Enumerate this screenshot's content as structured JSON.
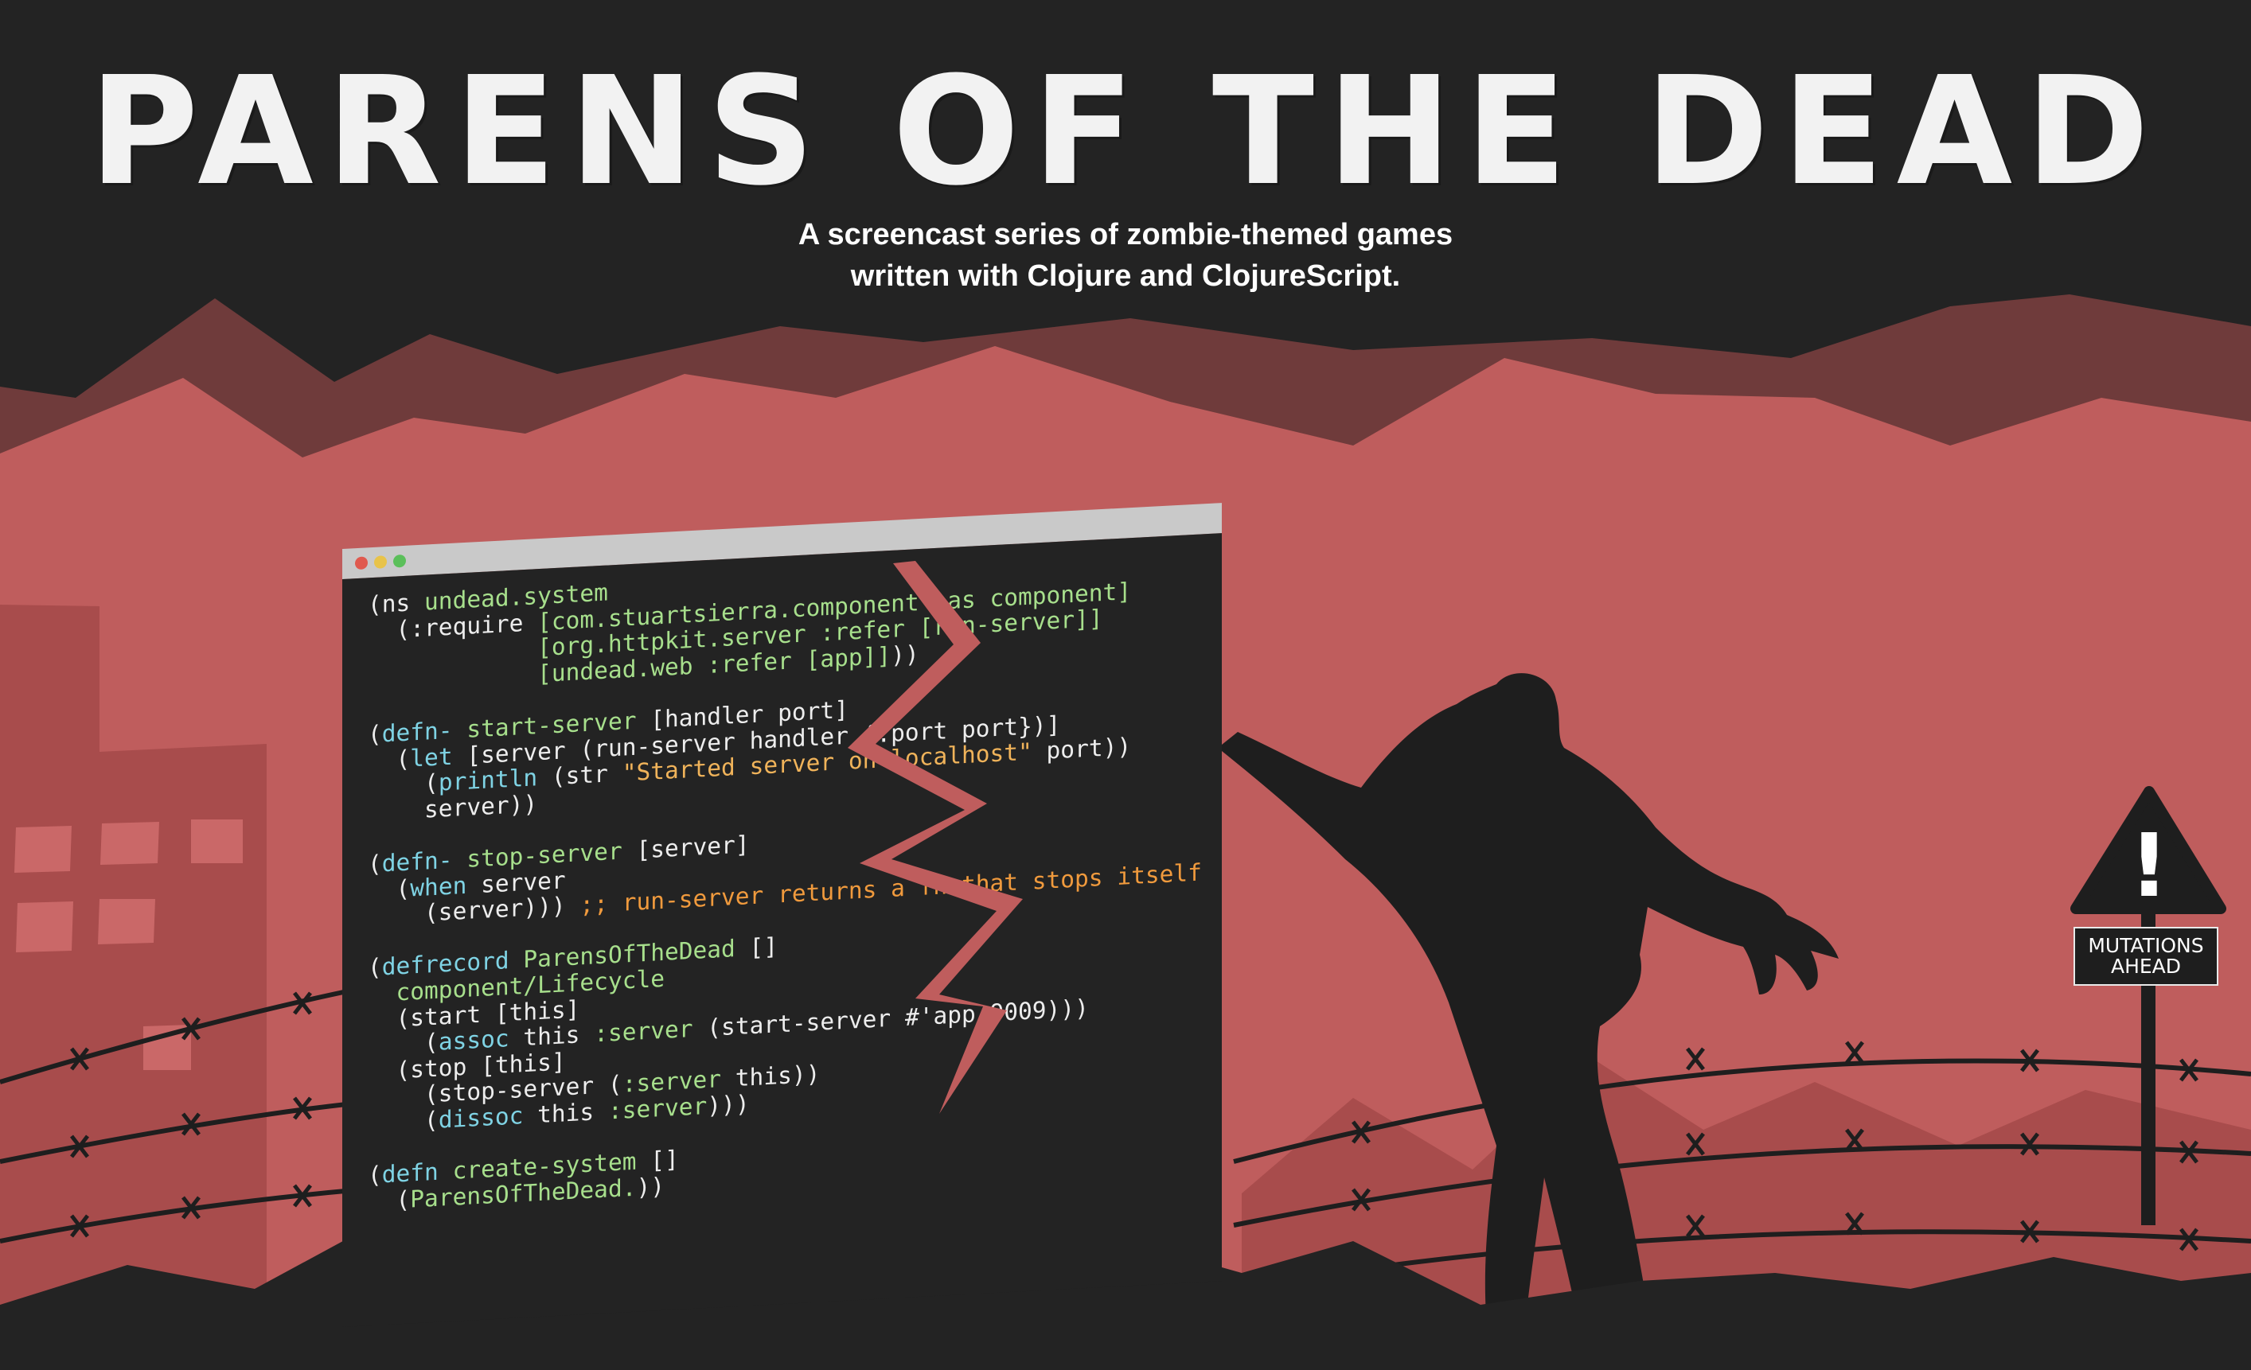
{
  "title": "PARENS OF THE DEAD",
  "subtitle": {
    "line1": "A screencast series of zombie-themed games",
    "line2": "written with Clojure and ClojureScript."
  },
  "sign": {
    "symbol": "!",
    "line1": "MUTATIONS",
    "line2": "AHEAD"
  },
  "code": [
    [
      [
        "p",
        "(ns "
      ],
      [
        "n",
        "undead.system"
      ]
    ],
    [
      [
        "p",
        "  (:require "
      ],
      [
        "n",
        "[com.stuartsierra.component :as component]"
      ]
    ],
    [
      [
        "n",
        "            [org.httpkit.server :refer [run-server]]"
      ]
    ],
    [
      [
        "n",
        "            [undead.web :refer [app]]"
      ],
      [
        "p",
        "))"
      ]
    ],
    [],
    [
      [
        "p",
        "("
      ],
      [
        "k",
        "defn-"
      ],
      [
        "n",
        " start-server"
      ],
      [
        "p",
        " [handler port]"
      ]
    ],
    [
      [
        "p",
        "  ("
      ],
      [
        "k",
        "let"
      ],
      [
        "p",
        " [server (run-server handler {:port port})]"
      ]
    ],
    [
      [
        "p",
        "    ("
      ],
      [
        "k",
        "println"
      ],
      [
        "p",
        " (str "
      ],
      [
        "s",
        "\"Started server on localhost\""
      ],
      [
        "p",
        " port))"
      ]
    ],
    [
      [
        "p",
        "    server))"
      ]
    ],
    [],
    [
      [
        "p",
        "("
      ],
      [
        "k",
        "defn-"
      ],
      [
        "n",
        " stop-server"
      ],
      [
        "p",
        " [server]"
      ]
    ],
    [
      [
        "p",
        "  ("
      ],
      [
        "k",
        "when"
      ],
      [
        "p",
        " server"
      ]
    ],
    [
      [
        "p",
        "    (server))) "
      ],
      [
        "c",
        ";; run-server returns a fn that stops itself"
      ]
    ],
    [],
    [
      [
        "p",
        "("
      ],
      [
        "k",
        "defrecord"
      ],
      [
        "n",
        " ParensOfTheDead"
      ],
      [
        "p",
        " []"
      ]
    ],
    [
      [
        "n",
        "  component/Lifecycle"
      ]
    ],
    [
      [
        "p",
        "  (start [this]"
      ]
    ],
    [
      [
        "p",
        "    ("
      ],
      [
        "k",
        "assoc"
      ],
      [
        "p",
        " this "
      ],
      [
        "n",
        ":server"
      ],
      [
        "p",
        " (start-server #'app 9009)))"
      ]
    ],
    [
      [
        "p",
        "  (stop [this]"
      ]
    ],
    [
      [
        "p",
        "    (stop-server ("
      ],
      [
        "n",
        ":server"
      ],
      [
        "p",
        " this))"
      ]
    ],
    [
      [
        "p",
        "    ("
      ],
      [
        "k",
        "dissoc"
      ],
      [
        "p",
        " this "
      ],
      [
        "n",
        ":server"
      ],
      [
        "p",
        ")))"
      ]
    ],
    [],
    [
      [
        "p",
        "("
      ],
      [
        "k",
        "defn"
      ],
      [
        "n",
        " create-system"
      ],
      [
        "p",
        " []"
      ]
    ],
    [
      [
        "p",
        "  ("
      ],
      [
        "n",
        "ParensOfTheDead."
      ],
      [
        "p",
        "))"
      ]
    ]
  ],
  "colors": {
    "background": "#232323",
    "sky": "#bf5d5d",
    "far_mountains": "#6f3b3b",
    "code_keyword": "#7fd3e4",
    "code_name": "#a7df8c",
    "code_comment": "#f09a3d"
  },
  "icons": [
    "zombie-silhouette",
    "barbed-wire",
    "warning-sign",
    "window-dots",
    "crack"
  ]
}
